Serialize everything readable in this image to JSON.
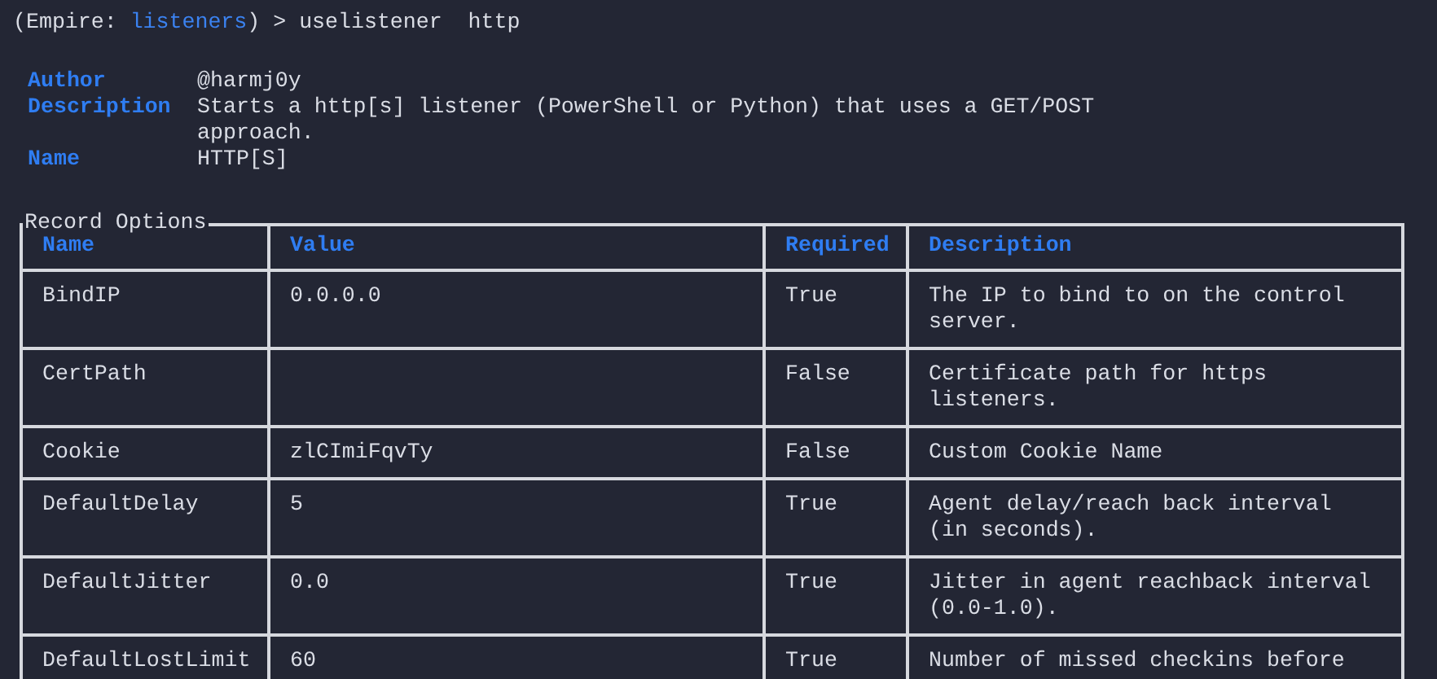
{
  "prompt": {
    "open": "(Empire: ",
    "context": "listeners",
    "close": ") > ",
    "command": "uselistener  http"
  },
  "info": [
    {
      "key": "Author",
      "value": "@harmj0y"
    },
    {
      "key": "Description",
      "value": "Starts a http[s] listener (PowerShell or Python) that uses a GET/POST approach."
    },
    {
      "key": "Name",
      "value": "HTTP[S]"
    }
  ],
  "table": {
    "title": "Record Options",
    "columns": [
      "Name",
      "Value",
      "Required",
      "Description"
    ],
    "rows": [
      [
        "BindIP",
        "0.0.0.0",
        "True",
        "The IP to bind to on the control server."
      ],
      [
        "CertPath",
        "",
        "False",
        "Certificate path for https listeners."
      ],
      [
        "Cookie",
        "zlCImiFqvTy",
        "False",
        "Custom Cookie Name"
      ],
      [
        "DefaultDelay",
        "5",
        "True",
        "Agent delay/reach back interval (in seconds)."
      ],
      [
        "DefaultJitter",
        "0.0",
        "True",
        "Jitter in agent reachback interval (0.0-1.0)."
      ],
      [
        "DefaultLostLimit",
        "60",
        "True",
        "Number of missed checkins before"
      ]
    ]
  }
}
